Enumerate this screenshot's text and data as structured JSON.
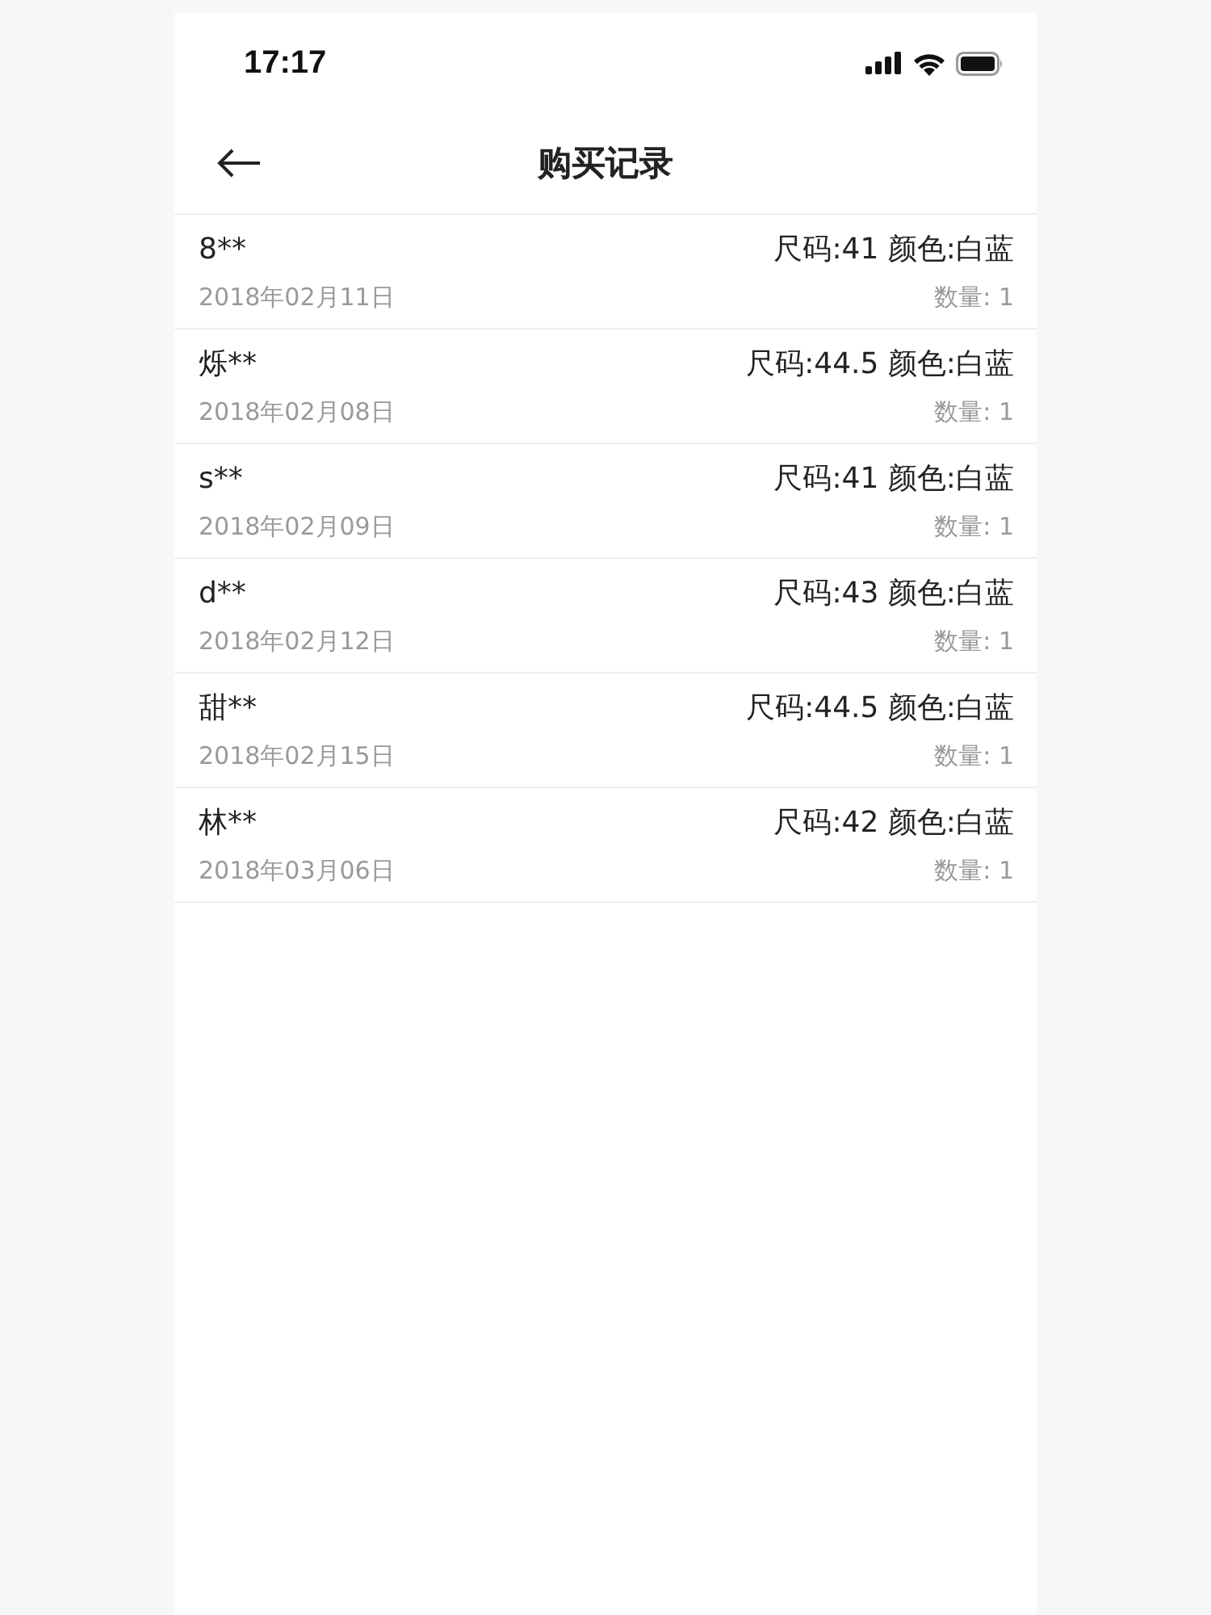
{
  "status_bar": {
    "time": "17:17"
  },
  "nav": {
    "title": "购买记录"
  },
  "records": [
    {
      "buyer": "8**",
      "spec": "尺码:41 颜色:白蓝",
      "date": "2018年02月11日",
      "quantity": "数量: 1"
    },
    {
      "buyer": "烁**",
      "spec": "尺码:44.5 颜色:白蓝",
      "date": "2018年02月08日",
      "quantity": "数量: 1"
    },
    {
      "buyer": "s**",
      "spec": "尺码:41 颜色:白蓝",
      "date": "2018年02月09日",
      "quantity": "数量: 1"
    },
    {
      "buyer": "d**",
      "spec": "尺码:43 颜色:白蓝",
      "date": "2018年02月12日",
      "quantity": "数量: 1"
    },
    {
      "buyer": "甜**",
      "spec": "尺码:44.5 颜色:白蓝",
      "date": "2018年02月15日",
      "quantity": "数量: 1"
    },
    {
      "buyer": "林**",
      "spec": "尺码:42 颜色:白蓝",
      "date": "2018年03月06日",
      "quantity": "数量: 1"
    }
  ]
}
